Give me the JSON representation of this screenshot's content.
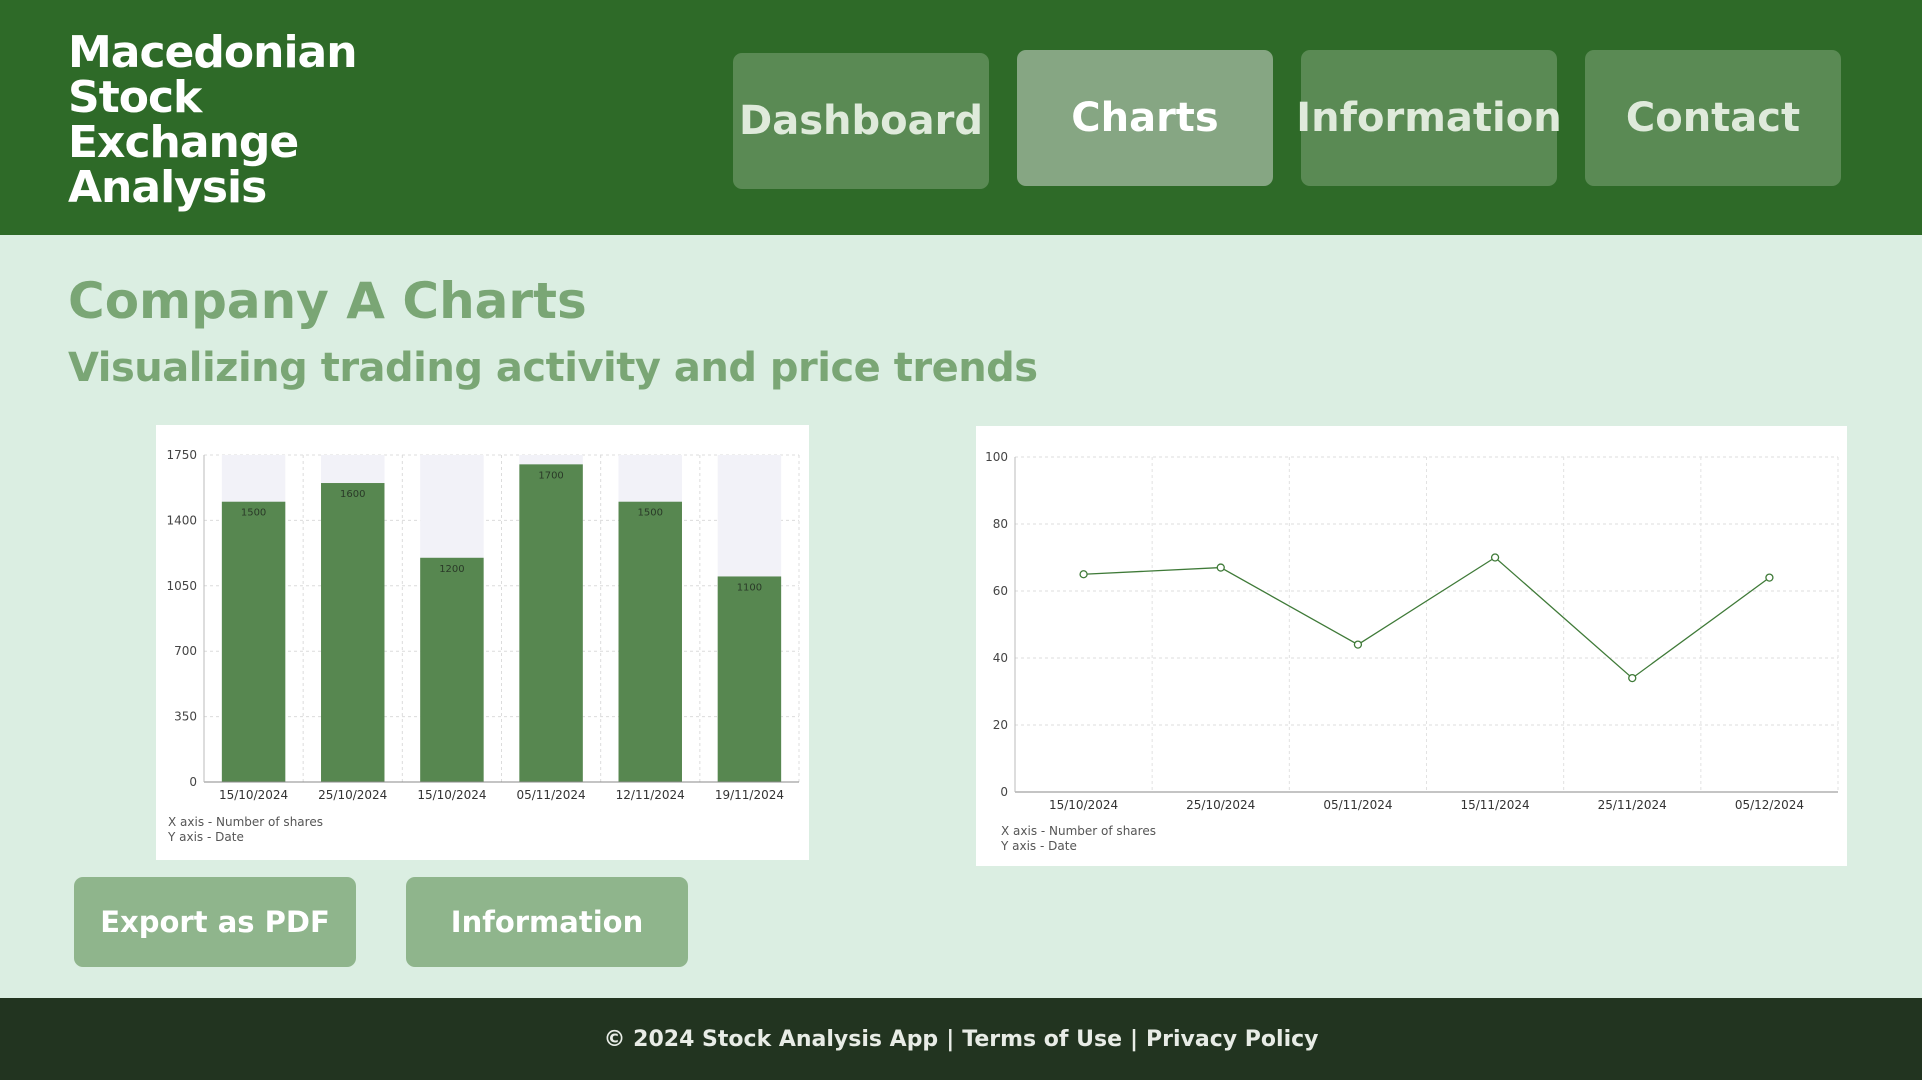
{
  "header": {
    "logo_lines": [
      "Macedonian",
      "Stock",
      "Exchange",
      "Analysis"
    ],
    "nav": [
      {
        "label": "Dashboard"
      },
      {
        "label": "Charts"
      },
      {
        "label": "Information"
      },
      {
        "label": "Contact"
      }
    ]
  },
  "main": {
    "title": "Company A Charts",
    "subtitle": "Visualizing trading activity and price trends"
  },
  "chart_data": [
    {
      "type": "bar",
      "categories": [
        "15/10/2024",
        "25/10/2024",
        "15/10/2024",
        "05/11/2024",
        "12/11/2024",
        "19/11/2024"
      ],
      "values": [
        1500,
        1600,
        1200,
        1700,
        1500,
        1100
      ],
      "value_labels": [
        "1500",
        "1600",
        "1200",
        "1700",
        "1500",
        "1100"
      ],
      "yticks": [
        0,
        350,
        700,
        1050,
        1400,
        1750
      ],
      "ylim": [
        0,
        1750
      ],
      "notes": [
        "X axis - Number of shares",
        "Y axis - Date"
      ],
      "grid": true,
      "colors": {
        "bar": "#578750",
        "background_bar": "#f2f2f8"
      }
    },
    {
      "type": "line",
      "x": [
        "15/10/2024",
        "25/10/2024",
        "05/11/2024",
        "15/11/2024",
        "25/11/2024",
        "05/12/2024"
      ],
      "values": [
        65,
        67,
        44,
        70,
        34,
        64
      ],
      "yticks": [
        0,
        20,
        40,
        60,
        80,
        100
      ],
      "ylim": [
        0,
        100
      ],
      "notes": [
        "X axis - Number of shares",
        "Y axis - Date"
      ],
      "grid": true,
      "colors": {
        "line": "#3f7a38"
      }
    }
  ],
  "actions": {
    "export_label": "Export as PDF",
    "info_label": "Information"
  },
  "footer": {
    "copyright": "© 2024 Stock Analysis App",
    "terms": "Terms of Use",
    "privacy": "Privacy Policy"
  }
}
